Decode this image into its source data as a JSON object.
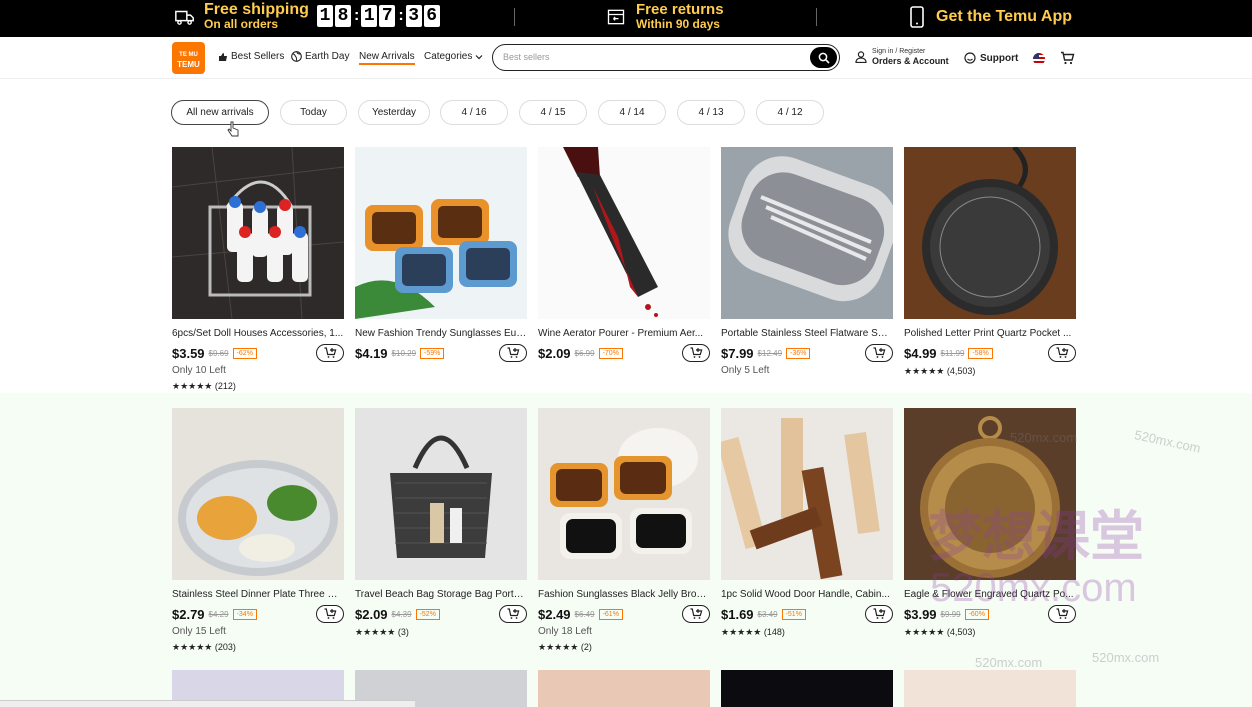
{
  "topbar": {
    "shipping_title": "Free shipping",
    "shipping_sub": "On all orders",
    "countdown_digits": [
      "1",
      "8",
      "1",
      "7",
      "3",
      "6"
    ],
    "returns_title": "Free returns",
    "returns_sub": "Within 90 days",
    "app_label": "Get the Temu App"
  },
  "header": {
    "logo_text_top": "TE MU",
    "logo_text_bottom": "TEMU",
    "nav": {
      "best_sellers": "Best Sellers",
      "earth_day": "Earth Day",
      "new_arrivals": "New Arrivals",
      "categories": "Categories"
    },
    "search_placeholder": "Best sellers",
    "account_small": "Sign in / Register",
    "account_big": "Orders & Account",
    "support": "Support"
  },
  "filters": [
    "All new arrivals",
    "Today",
    "Yesterday",
    "4 / 16",
    "4 / 15",
    "4 / 14",
    "4 / 13",
    "4 / 12"
  ],
  "products": [
    {
      "title": "6pcs/Set Doll Houses Accessories, 1...",
      "price": "$3.59",
      "old": "$9.69",
      "discount": "-62%",
      "stock": "Only 10 Left",
      "rating": "★★★★★ (212)"
    },
    {
      "title": "New Fashion Trendy Sunglasses Eur...",
      "price": "$4.19",
      "old": "$10.29",
      "discount": "-59%",
      "stock": "",
      "rating": ""
    },
    {
      "title": "Wine Aerator Pourer - Premium Aer...",
      "price": "$2.09",
      "old": "$6.99",
      "discount": "-70%",
      "stock": "",
      "rating": ""
    },
    {
      "title": "Portable Stainless Steel Flatware Set,...",
      "price": "$7.99",
      "old": "$12.49",
      "discount": "-36%",
      "stock": "Only 5 Left",
      "rating": ""
    },
    {
      "title": "Polished Letter Print Quartz Pocket ...",
      "price": "$4.99",
      "old": "$11.99",
      "discount": "-58%",
      "stock": "",
      "rating": "★★★★★ (4,503)"
    },
    {
      "title": "Stainless Steel Dinner Plate Three Se...",
      "price": "$2.79",
      "old": "$4.29",
      "discount": "-34%",
      "stock": "Only 15 Left",
      "rating": "★★★★★ (203)"
    },
    {
      "title": "Travel Beach Bag Storage Bag Porta...",
      "price": "$2.09",
      "old": "$4.39",
      "discount": "-52%",
      "stock": "",
      "rating": "★★★★★ (3)"
    },
    {
      "title": "Fashion Sunglasses Black Jelly Brow...",
      "price": "$2.49",
      "old": "$6.49",
      "discount": "-61%",
      "stock": "Only 18 Left",
      "rating": "★★★★★ (2)"
    },
    {
      "title": "1pc Solid Wood Door Handle, Cabin...",
      "price": "$1.69",
      "old": "$3.49",
      "discount": "-51%",
      "stock": "",
      "rating": "★★★★★ (148)"
    },
    {
      "title": "Eagle & Flower Engraved Quartz Po...",
      "price": "$3.99",
      "old": "$9.99",
      "discount": "-60%",
      "stock": "",
      "rating": "★★★★★ (4,503)"
    }
  ],
  "watermark": {
    "cn": "梦想课堂",
    "big": "520mx.com",
    "small": "520mx.com"
  },
  "colors": {
    "brand": "#fb7701",
    "banner": "#000000",
    "banner_text": "#ffcc4d"
  }
}
